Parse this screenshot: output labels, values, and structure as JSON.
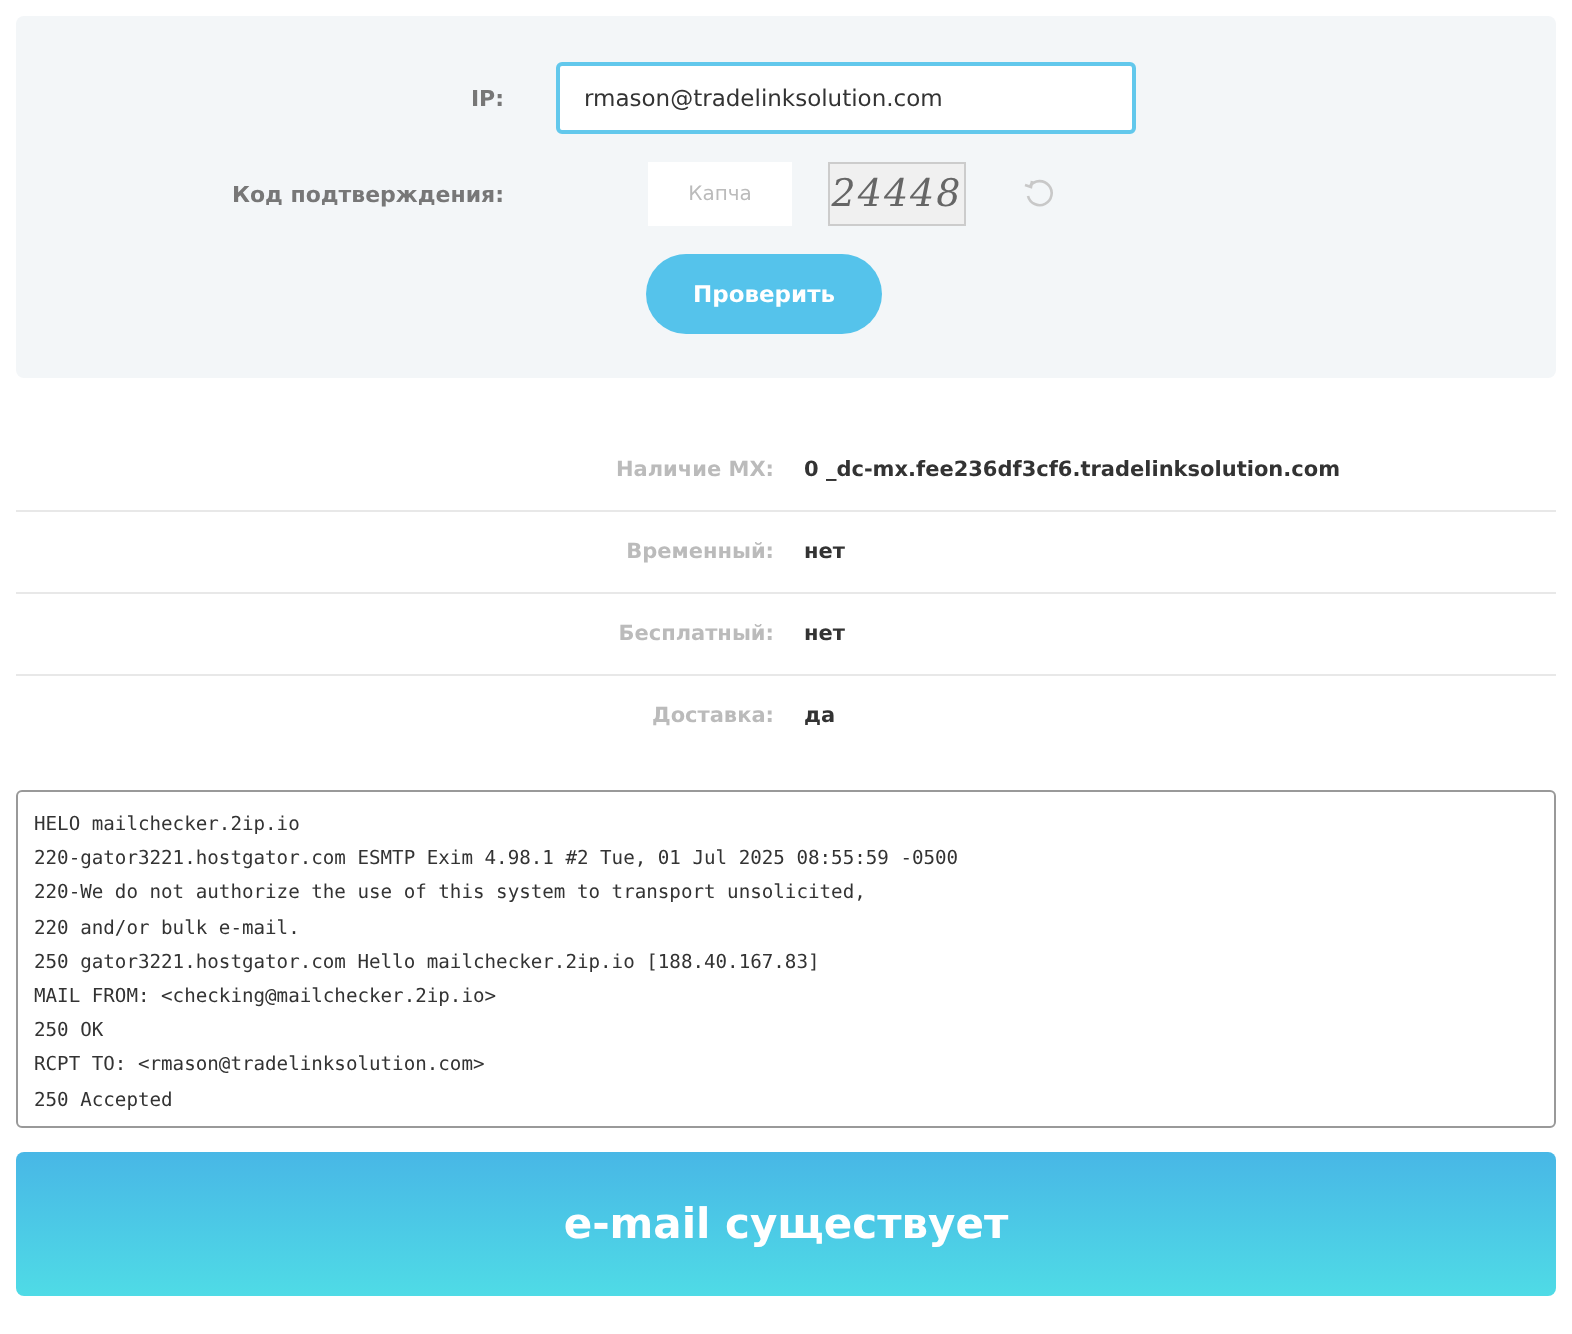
{
  "form": {
    "email_label": "IP:",
    "email_value": "rmason@tradelinksolution.com",
    "captcha_label": "Код подтверждения:",
    "captcha_placeholder": "Капча",
    "captcha_text": "24448",
    "submit": "Проверить"
  },
  "results": [
    {
      "label": "Наличие MX:",
      "value": "0 _dc-mx.fee236df3cf6.tradelinksolution.com"
    },
    {
      "label": "Временный:",
      "value": "нет"
    },
    {
      "label": "Бесплатный:",
      "value": "нет"
    },
    {
      "label": "Доставка:",
      "value": "да"
    }
  ],
  "log": [
    "HELO mailchecker.2ip.io",
    "220-gator3221.hostgator.com ESMTP Exim 4.98.1 #2 Tue, 01 Jul 2025 08:55:59 -0500",
    "220-We do not authorize the use of this system to transport unsolicited,",
    "220 and/or bulk e-mail.",
    "250 gator3221.hostgator.com Hello mailchecker.2ip.io [188.40.167.83]",
    "MAIL FROM: <checking@mailchecker.2ip.io>",
    "250 OK",
    "RCPT TO: <rmason@tradelinksolution.com>",
    "250 Accepted"
  ],
  "verdict": "e-mail существует"
}
